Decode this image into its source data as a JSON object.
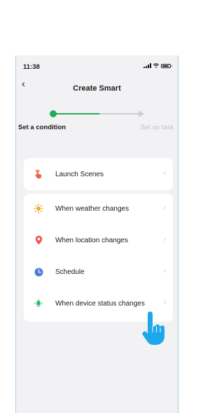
{
  "status": {
    "time": "11:38"
  },
  "nav": {
    "title": "Create Smart"
  },
  "steps": {
    "step1": "Set a condition",
    "step2": "Set up task"
  },
  "launch": {
    "label": "Launch Scenes"
  },
  "conditions": [
    {
      "label": "When weather changes",
      "icon": "sun-icon"
    },
    {
      "label": "When location changes",
      "icon": "location-pin-icon"
    },
    {
      "label": "Schedule",
      "icon": "clock-icon"
    },
    {
      "label": "When device status changes",
      "icon": "device-icon"
    }
  ],
  "colors": {
    "accent": "#1fae56",
    "sun": "#f6a623",
    "location": "#f05a4f",
    "schedule": "#4a7fd4",
    "device": "#2fbf71",
    "launch": "#e8663d",
    "pointer": "#1ea7ea"
  }
}
